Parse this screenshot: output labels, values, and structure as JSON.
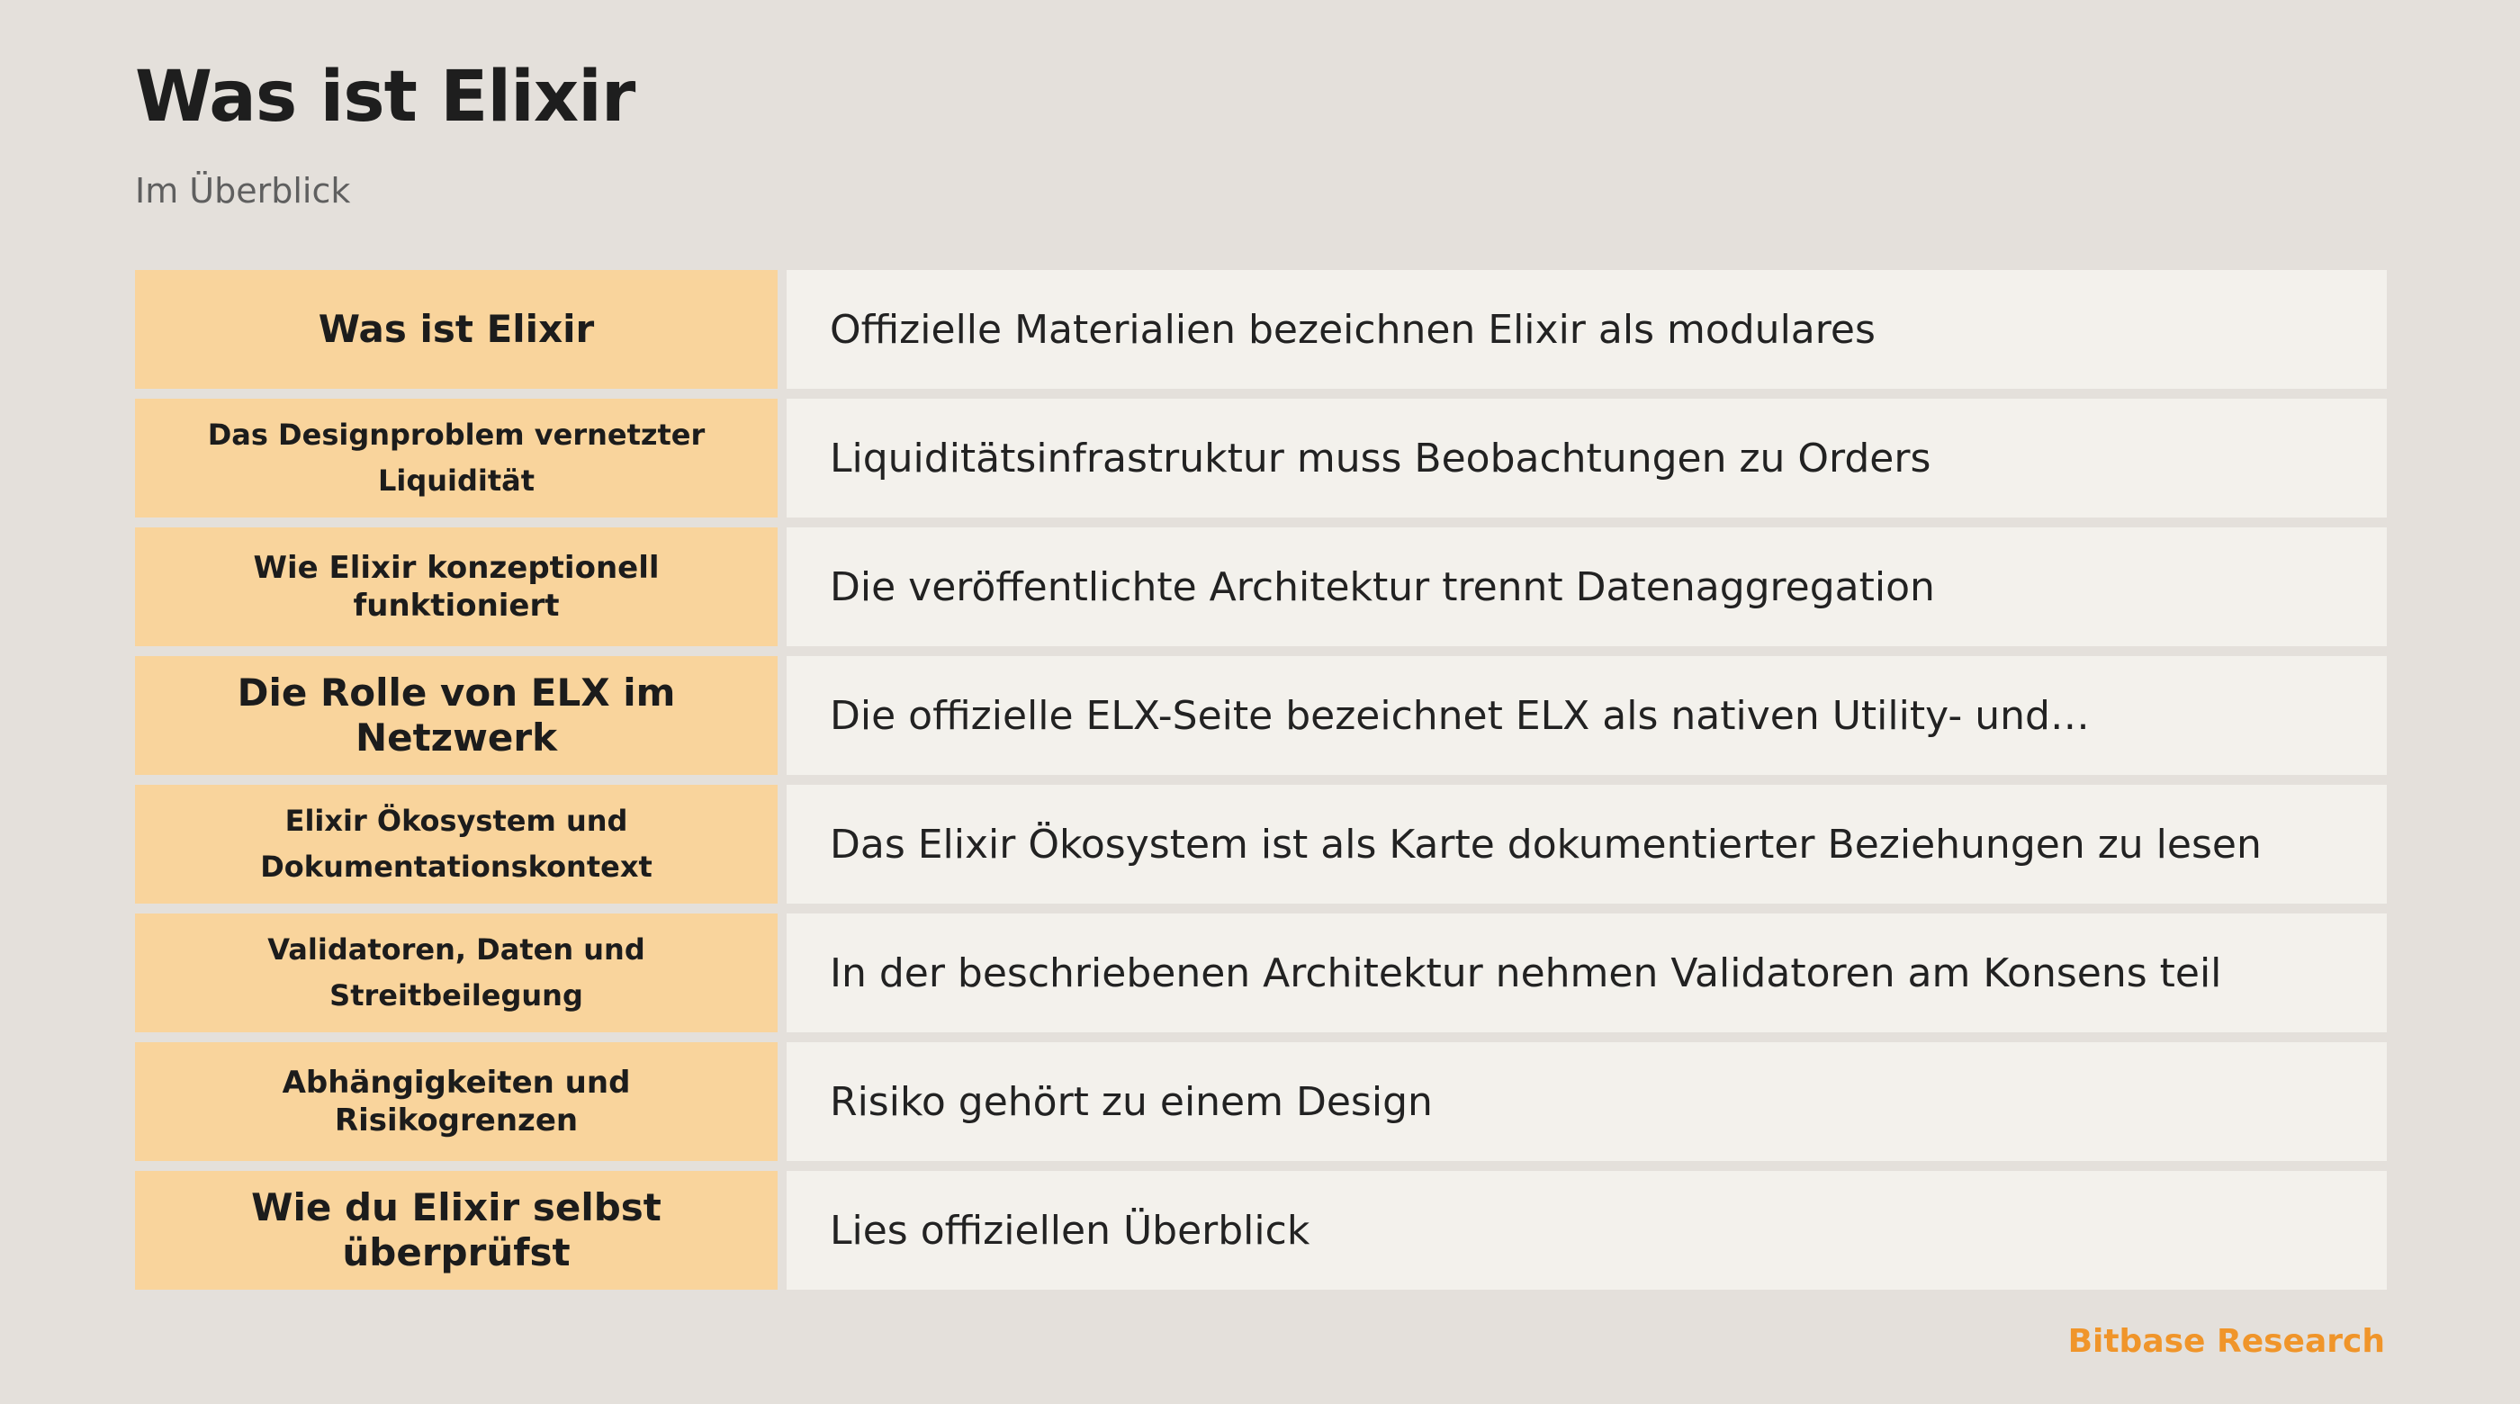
{
  "header": {
    "title": "Was ist Elixir",
    "subtitle": "Im Überblick"
  },
  "rows": [
    {
      "label": "Was ist Elixir",
      "text": "Offizielle Materialien bezeichnen Elixir als modulares"
    },
    {
      "label": "Das Designproblem vernetzter Liquidität",
      "text": "Liquiditätsinfrastruktur muss Beobachtungen zu Orders"
    },
    {
      "label": "Wie Elixir konzeptionell funktioniert",
      "text": "Die veröffentlichte Architektur trennt Datenaggregation"
    },
    {
      "label": "Die Rolle von ELX im Netzwerk",
      "text": "Die offizielle ELX-Seite bezeichnet ELX als nativen Utility- und…"
    },
    {
      "label": "Elixir Ökosystem und Dokumentationskontext",
      "text": "Das Elixir Ökosystem ist als Karte dokumentierter Beziehungen zu lesen"
    },
    {
      "label": "Validatoren, Daten und Streitbeilegung",
      "text": "In der beschriebenen Architektur nehmen Validatoren am Konsens teil"
    },
    {
      "label": "Abhängigkeiten und Risikogrenzen",
      "text": "Risiko gehört zu einem Design"
    },
    {
      "label": "Wie du Elixir selbst überprüfst",
      "text": "Lies offiziellen Überblick"
    }
  ],
  "footer": {
    "brand": "Bitbase Research"
  },
  "colors": {
    "background": "#e4e0db",
    "label_cell": "#f9d49c",
    "text_cell": "#f3f1ec",
    "brand": "#f0952a"
  }
}
